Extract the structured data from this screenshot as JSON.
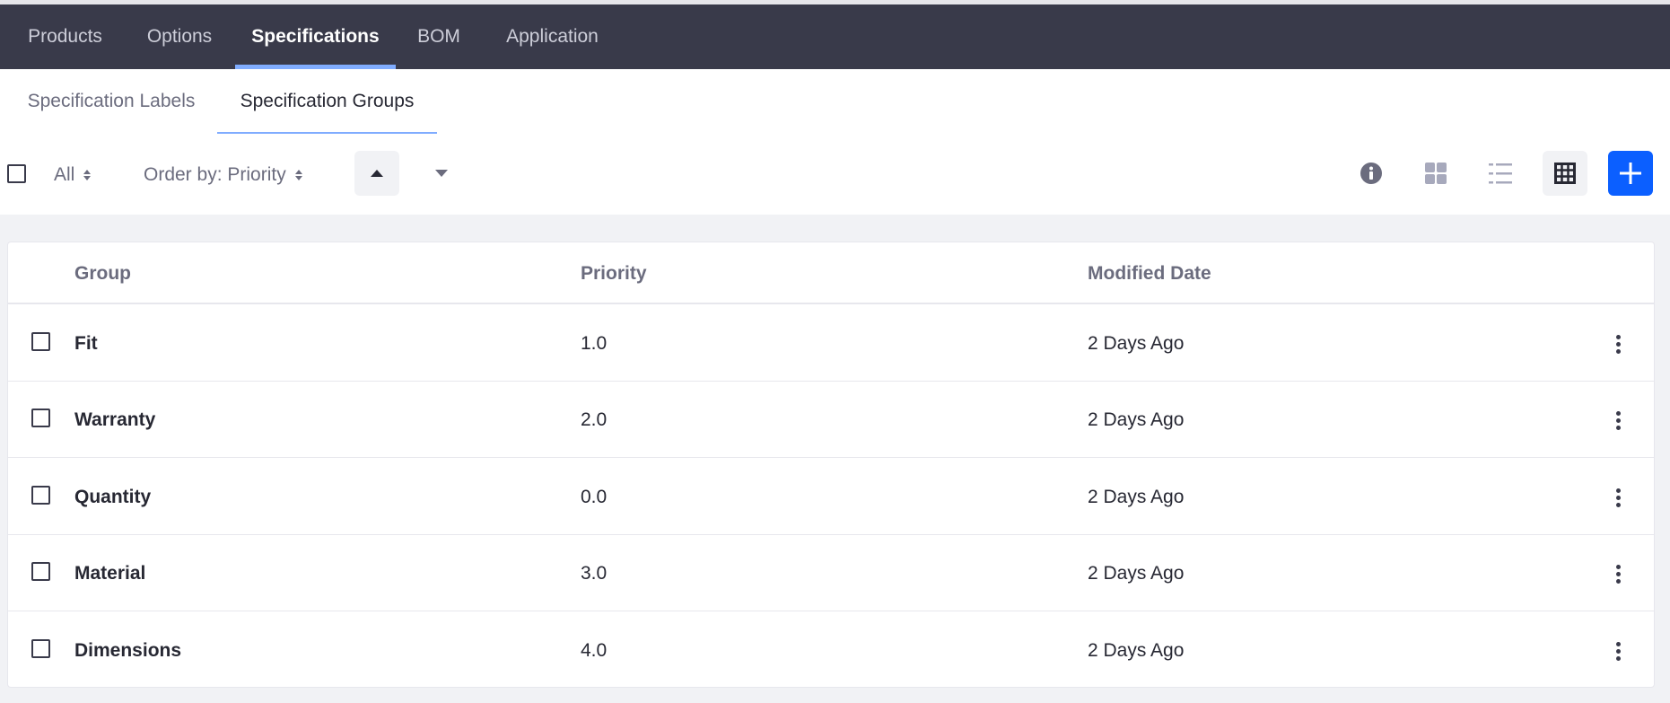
{
  "top_nav": {
    "tabs": [
      {
        "label": "Products"
      },
      {
        "label": "Options"
      },
      {
        "label": "Specifications",
        "active": true
      },
      {
        "label": "BOM"
      },
      {
        "label": "Application"
      }
    ]
  },
  "sub_nav": {
    "tabs": [
      {
        "label": "Specification Labels"
      },
      {
        "label": "Specification Groups",
        "active": true
      }
    ]
  },
  "toolbar": {
    "filter_label": "All",
    "order_by_label": "Order by: Priority",
    "sort_ascending_icon": "caret-up-icon",
    "sort_descending_icon": "caret-down-icon",
    "info_icon": "info-icon",
    "cards_view_icon": "cards-view-icon",
    "list_view_icon": "list-view-icon",
    "table_view_icon": "table-view-icon",
    "add_icon": "plus-icon",
    "accent_color": "#0b5fff"
  },
  "table": {
    "columns": [
      "Group",
      "Priority",
      "Modified Date"
    ],
    "rows": [
      {
        "group": "Fit",
        "priority": "1.0",
        "modified": "2 Days Ago"
      },
      {
        "group": "Warranty",
        "priority": "2.0",
        "modified": "2 Days Ago"
      },
      {
        "group": "Quantity",
        "priority": "0.0",
        "modified": "2 Days Ago"
      },
      {
        "group": "Material",
        "priority": "3.0",
        "modified": "2 Days Ago"
      },
      {
        "group": "Dimensions",
        "priority": "4.0",
        "modified": "2 Days Ago"
      }
    ]
  }
}
